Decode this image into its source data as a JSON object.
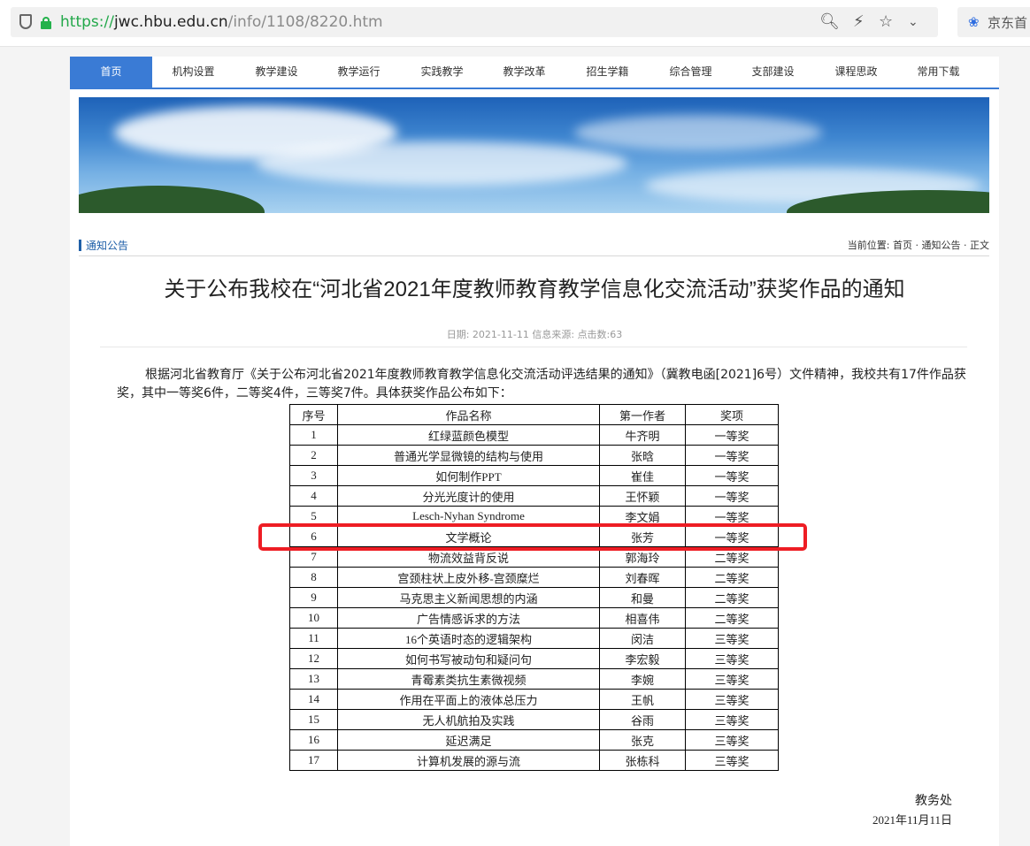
{
  "browser": {
    "url_scheme": "https://",
    "url_host": "jwc.hbu.edu.cn",
    "url_path": "/info/1108/8220.htm",
    "ext_label": "京东首"
  },
  "nav": {
    "items": [
      "首页",
      "机构设置",
      "教学建设",
      "教学运行",
      "实践教学",
      "教学改革",
      "招生学籍",
      "综合管理",
      "支部建设",
      "课程思政",
      "常用下载"
    ],
    "active": "首页"
  },
  "section": {
    "title": "通知公告",
    "breadcrumb_label": "当前位置:",
    "breadcrumb": "首页 · 通知公告 · 正文"
  },
  "article": {
    "title": "关于公布我校在“河北省2021年度教师教育教学信息化交流活动”获奖作品的通知",
    "meta": "日期: 2021-11-11 信息来源: 点击数:63",
    "paragraph": "根据河北省教育厅《关于公布河北省2021年度教师教育教学信息化交流活动评选结果的通知》（冀教电函[2021]6号）文件精神，我校共有17件作品获奖，其中一等奖6件，二等奖4件，三等奖7件。具体获奖作品公布如下：",
    "signature": "教务处",
    "date": "2021年11月11日"
  },
  "table": {
    "headers": [
      "序号",
      "作品名称",
      "第一作者",
      "奖项"
    ],
    "rows": [
      [
        "1",
        "红绿蓝颜色模型",
        "牛齐明",
        "一等奖"
      ],
      [
        "2",
        "普通光学显微镜的结构与使用",
        "张晗",
        "一等奖"
      ],
      [
        "3",
        "如何制作PPT",
        "崔佳",
        "一等奖"
      ],
      [
        "4",
        "分光光度计的使用",
        "王怀颖",
        "一等奖"
      ],
      [
        "5",
        "Lesch-Nyhan Syndrome",
        "李文娟",
        "一等奖"
      ],
      [
        "6",
        "文学概论",
        "张芳",
        "一等奖"
      ],
      [
        "7",
        "物流效益背反说",
        "郭海玲",
        "二等奖"
      ],
      [
        "8",
        "宫颈柱状上皮外移-宫颈糜烂",
        "刘春晖",
        "二等奖"
      ],
      [
        "9",
        "马克思主义新闻思想的内涵",
        "和曼",
        "二等奖"
      ],
      [
        "10",
        "广告情感诉求的方法",
        "相喜伟",
        "二等奖"
      ],
      [
        "11",
        "16个英语时态的逻辑架构",
        "闵洁",
        "三等奖"
      ],
      [
        "12",
        "如何书写被动句和疑问句",
        "李宏毅",
        "三等奖"
      ],
      [
        "13",
        "青霉素类抗生素微视频",
        "李婉",
        "三等奖"
      ],
      [
        "14",
        "作用在平面上的液体总压力",
        "王帆",
        "三等奖"
      ],
      [
        "15",
        "无人机航拍及实践",
        "谷雨",
        "三等奖"
      ],
      [
        "16",
        "延迟满足",
        "张克",
        "三等奖"
      ],
      [
        "17",
        "计算机发展的源与流",
        "张栋科",
        "三等奖"
      ]
    ],
    "highlight_row": 6
  },
  "colors": {
    "nav_active": "#3a7bd5",
    "highlight": "#ee1d24",
    "link": "#1f5fa8"
  }
}
